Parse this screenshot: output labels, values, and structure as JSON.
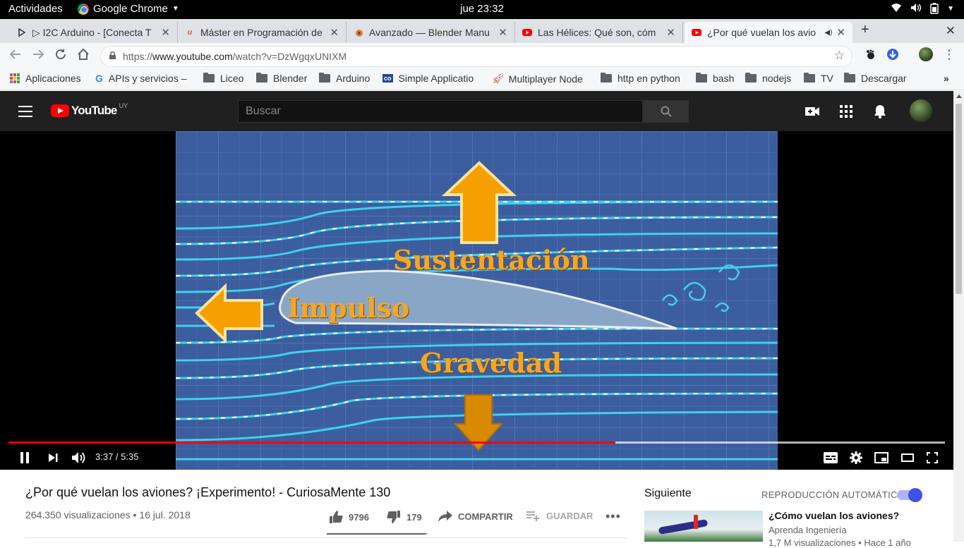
{
  "system": {
    "activities": "Actividades",
    "app_name": "Google Chrome",
    "clock": "jue 23:32"
  },
  "tabs": [
    {
      "title": "▷ I2C Arduino - [Conecta T",
      "icon": "arduino-icon"
    },
    {
      "title": "Máster en Programación de",
      "icon": "udemy-icon"
    },
    {
      "title": "Avanzado — Blender Manu",
      "icon": "blender-icon"
    },
    {
      "title": "Las Hélices: Qué son, cóm",
      "icon": "youtube-icon"
    },
    {
      "title": "¿Por qué vuelan los avio",
      "icon": "youtube-icon",
      "active": true,
      "audio": true
    }
  ],
  "address": {
    "url_prefix": "https://",
    "url_host": "www.youtube.com",
    "url_path": "/watch?v=DzWgqxUNIXM"
  },
  "bookmarks": [
    {
      "label": "Aplicaciones",
      "icon": "apps-icon"
    },
    {
      "label": "APIs y servicios –",
      "icon": "google-icon"
    },
    {
      "label": "Liceo",
      "icon": "folder-icon"
    },
    {
      "label": "Blender",
      "icon": "folder-icon"
    },
    {
      "label": "Arduino",
      "icon": "folder-icon"
    },
    {
      "label": "Simple Applicatio",
      "icon": "co-icon"
    },
    {
      "label": "Multiplayer Node",
      "icon": "rocket-icon"
    },
    {
      "label": "http en python",
      "icon": "folder-icon"
    },
    {
      "label": "bash",
      "icon": "folder-icon"
    },
    {
      "label": "nodejs",
      "icon": "folder-icon"
    },
    {
      "label": "TV",
      "icon": "folder-icon"
    },
    {
      "label": "Descargar",
      "icon": "folder-icon"
    }
  ],
  "youtube": {
    "logo_text": "YouTube",
    "country_code": "UY",
    "search_placeholder": "Buscar"
  },
  "player": {
    "current_time": "3:37",
    "duration": "5:35",
    "time_display": "3:37 / 5:35",
    "progress_fraction": 0.648,
    "buffered_fraction": 1.0,
    "video_labels": {
      "lift": "Sustentación",
      "thrust": "Impulso",
      "gravity": "Gravedad"
    }
  },
  "video": {
    "title": "¿Por qué vuelan los aviones? ¡Experimento! - CuriosaMente 130",
    "views_date": "264.350 visualizaciones • 16 jul. 2018",
    "likes": "9796",
    "dislikes": "179",
    "share": "COMPARTIR",
    "save": "GUARDAR",
    "like_fraction": 0.982
  },
  "sidebar": {
    "next_label": "Siguiente",
    "autoplay_label": "REPRODUCCIÓN AUTOMÁTICA",
    "autoplay_on": true,
    "recommended": {
      "title": "¿Cómo vuelan los aviones?",
      "channel": "Aprenda Ingeniería",
      "meta": "1,7 M visualizaciones • Hace 1 año"
    }
  },
  "colors": {
    "youtube_red": "#ff0000",
    "youtube_dark": "#202020",
    "blueprint": "#3d5e9e",
    "arrow_orange": "#f5a000",
    "autoplay_blue": "#3f51e8"
  }
}
